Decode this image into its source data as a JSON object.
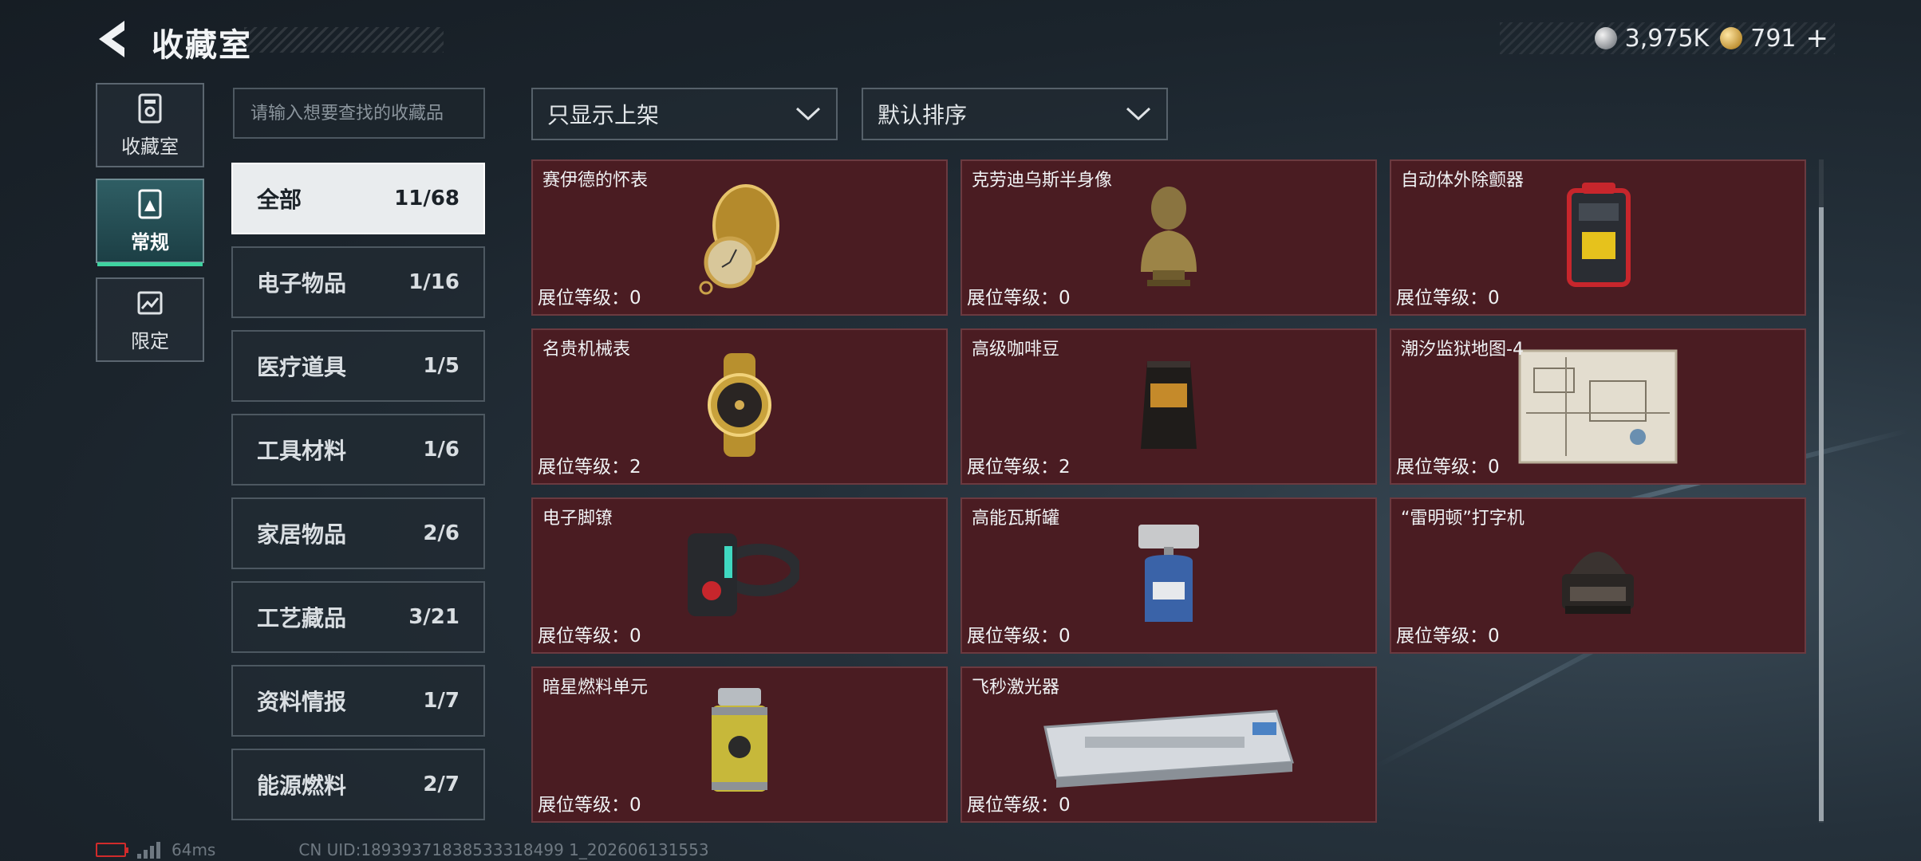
{
  "header": {
    "title": "收藏室",
    "currencies": [
      {
        "icon": "silver-coin-icon",
        "value": "3,975K"
      },
      {
        "icon": "gold-coin-icon",
        "value": "791"
      }
    ],
    "add_label": "+"
  },
  "rail": {
    "tabs": [
      {
        "label": "收藏室",
        "icon": "collection-room-icon",
        "active": false
      },
      {
        "label": "常规",
        "icon": "regular-icon",
        "active": true
      },
      {
        "label": "限定",
        "icon": "limited-icon",
        "active": false
      }
    ]
  },
  "search": {
    "placeholder": "请输入想要查找的收藏品"
  },
  "categories": [
    {
      "name": "全部",
      "count": "11/68",
      "active": true
    },
    {
      "name": "电子物品",
      "count": "1/16"
    },
    {
      "name": "医疗道具",
      "count": "1/5"
    },
    {
      "name": "工具材料",
      "count": "1/6"
    },
    {
      "name": "家居物品",
      "count": "2/6"
    },
    {
      "name": "工艺藏品",
      "count": "3/21"
    },
    {
      "name": "资料情报",
      "count": "1/7"
    },
    {
      "name": "能源燃料",
      "count": "2/7"
    }
  ],
  "filters": {
    "display": "只显示上架",
    "sort": "默认排序"
  },
  "items": [
    {
      "name": "赛伊德的怀表",
      "level": "展位等级：0",
      "icon": "pocket-watch-icon"
    },
    {
      "name": "克劳迪乌斯半身像",
      "level": "展位等级：0",
      "icon": "bust-statue-icon"
    },
    {
      "name": "自动体外除颤器",
      "level": "展位等级：0",
      "icon": "defibrillator-icon"
    },
    {
      "name": "名贵机械表",
      "level": "展位等级：2",
      "icon": "wristwatch-icon"
    },
    {
      "name": "高级咖啡豆",
      "level": "展位等级：2",
      "icon": "coffee-bag-icon"
    },
    {
      "name": "潮汐监狱地图-4",
      "level": "展位等级：0",
      "icon": "map-icon"
    },
    {
      "name": "电子脚镣",
      "level": "展位等级：0",
      "icon": "ankle-monitor-icon"
    },
    {
      "name": "高能瓦斯罐",
      "level": "展位等级：0",
      "icon": "gas-canister-icon"
    },
    {
      "name": "“雷明顿”打字机",
      "level": "展位等级：0",
      "icon": "typewriter-icon"
    },
    {
      "name": "暗星燃料单元",
      "level": "展位等级：0",
      "icon": "fuel-cell-icon"
    },
    {
      "name": "飞秒激光器",
      "level": "展位等级：0",
      "icon": "laser-device-icon"
    }
  ],
  "status": {
    "latency": "64ms",
    "uid": "CN UID:18939371838533318499 1_202606131553",
    "battery_color": "#d12b2b"
  }
}
